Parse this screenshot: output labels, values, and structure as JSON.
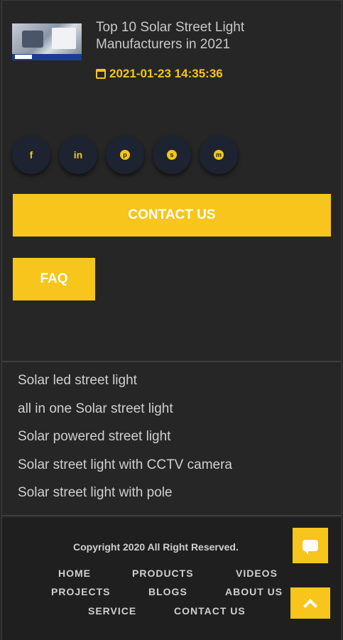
{
  "news": {
    "title": "Top 10 Solar Street Light Manufacturers in 2021",
    "date": "2021-01-23 14:35:36"
  },
  "social": [
    {
      "name": "facebook-icon",
      "glyph": "f"
    },
    {
      "name": "linkedin-icon",
      "glyph": "in"
    },
    {
      "name": "pinterest-icon",
      "glyph": "p"
    },
    {
      "name": "skype-icon",
      "glyph": "s"
    },
    {
      "name": "messenger-icon",
      "glyph": "m"
    }
  ],
  "buttons": {
    "contact": "CONTACT US",
    "faq": "FAQ"
  },
  "links": [
    "Solar led street light",
    "all in one Solar street light",
    "Solar powered street light",
    "Solar street light with CCTV camera",
    "Solar street light with pole"
  ],
  "footer": {
    "copyright": "Copyright 2020 All Right Reserved.",
    "nav": {
      "home": "HOME",
      "products": "PRODUCTS",
      "videos": "VIDEOS",
      "projects": "PROJECTS",
      "blogs": "BLOGS",
      "about": "ABOUT US",
      "service": "SERVICE",
      "contact": "CONTACT US"
    }
  },
  "colors": {
    "accent": "#f7c51b",
    "background": "#262626",
    "footer": "#1f1f1f",
    "social_bg": "#1d2330"
  }
}
